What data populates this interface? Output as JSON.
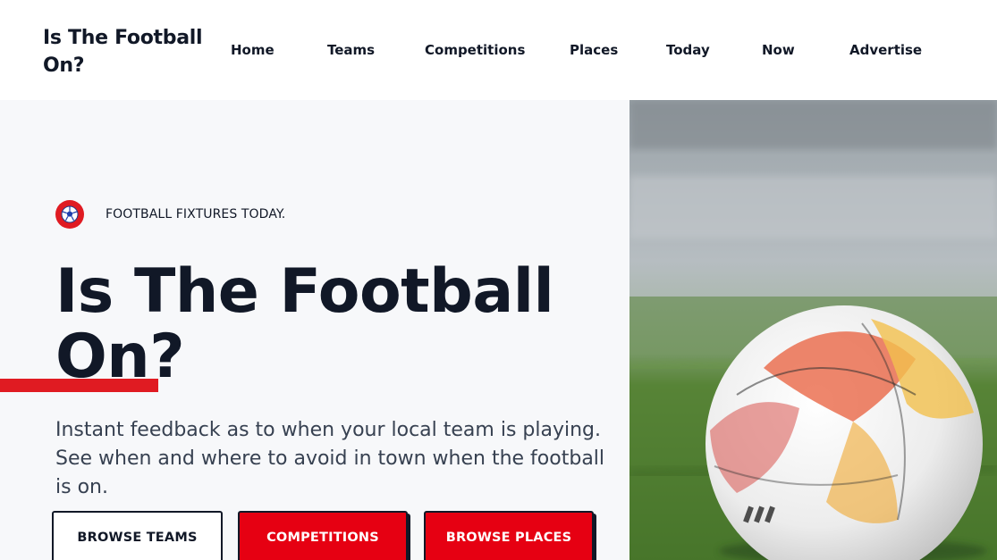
{
  "site": {
    "logo_text": "Is The Football On?"
  },
  "nav": {
    "items": [
      {
        "label": "Home"
      },
      {
        "label": "Teams"
      },
      {
        "label": "Competitions"
      },
      {
        "label": "Places"
      },
      {
        "label": "Today"
      },
      {
        "label": "Now"
      },
      {
        "label": "Advertise"
      }
    ]
  },
  "hero": {
    "kicker_icon": "soccer-ball-icon",
    "kicker_text": "FOOTBALL FIXTURES TODAY.",
    "title_line1": "Is The Football",
    "title_line2": "On?",
    "description": "Instant feedback as to when your local team is playing. See when and where to avoid in town when the football is on.",
    "buttons": {
      "browse_teams": "BROWSE TEAMS",
      "competitions": "COMPETITIONS",
      "browse_places": "BROWSE PLACES"
    },
    "image_alt": "football-on-grass-photo"
  },
  "colors": {
    "accent_red": "#e01b22",
    "button_red": "#e60012",
    "text_dark": "#111827",
    "hero_bg": "#f7f8fa"
  }
}
